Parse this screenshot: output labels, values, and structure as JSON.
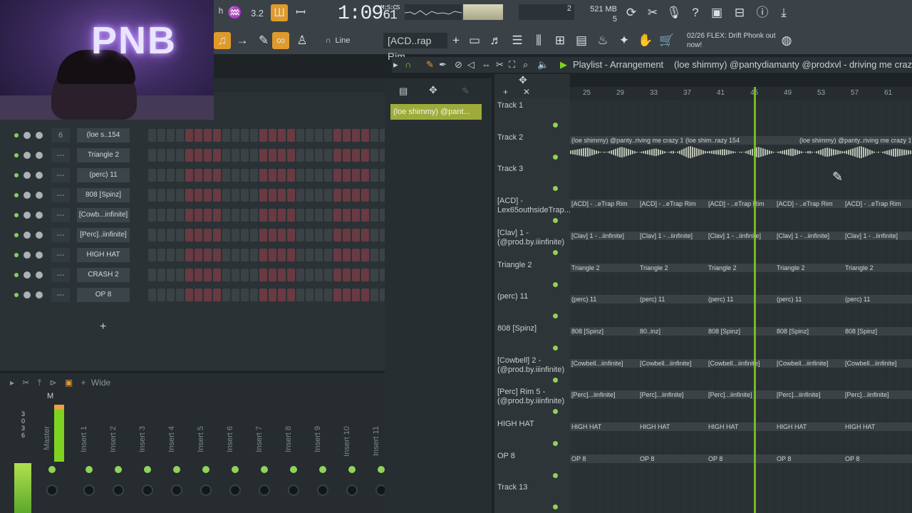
{
  "toolbar": {
    "time": "1:09",
    "time_sub": "61",
    "time_unit": "M:S:CS",
    "tempo": "3.2",
    "line_mode": "Line",
    "pattern": "[ACD..rap Rim",
    "memory": "521 MB",
    "cpu_top": "2",
    "cpu_bottom": "5",
    "news_date": "02/26",
    "news_text": "FLEX: Drift Phonk out now!"
  },
  "channel_rack": {
    "rows": [
      {
        "num": "6",
        "name": "(loe s..154"
      },
      {
        "num": "---",
        "name": "Triangle 2"
      },
      {
        "num": "---",
        "name": "(perc) 11"
      },
      {
        "num": "---",
        "name": "808 [Spinz]"
      },
      {
        "num": "---",
        "name": "[Cowb...infinite]"
      },
      {
        "num": "---",
        "name": "[Perc]..iinfinite]"
      },
      {
        "num": "---",
        "name": "HIGH HAT"
      },
      {
        "num": "---",
        "name": "CRASH 2"
      },
      {
        "num": "---",
        "name": "OP 8"
      }
    ],
    "add_label": "+"
  },
  "mixer": {
    "mode": "Wide",
    "master_label": "M",
    "scale": [
      "3",
      "0",
      "3",
      "6"
    ],
    "strips": [
      "Master",
      "Insert 1",
      "Insert 2",
      "Insert 3",
      "Insert 4",
      "Insert 5",
      "Insert 6",
      "Insert 7",
      "Insert 8",
      "Insert 9",
      "Insert 10",
      "Insert 11"
    ]
  },
  "picker": {
    "selected_clip": "(loe shimmy) @pant..."
  },
  "playlist": {
    "title": "Playlist - Arrangement",
    "subtitle": "(loe shimmy) @pantydiamanty @prodxvl - driving me crazy",
    "ruler": [
      "25",
      "29",
      "33",
      "37",
      "41",
      "45",
      "49",
      "53",
      "57",
      "61"
    ],
    "tracks": [
      {
        "name": "Track 1",
        "clips": []
      },
      {
        "name": "Track 2",
        "clips": [
          "(loe shimmy) @panty..riving me crazy 154",
          "(loe shim..razy 154",
          "(loe shimmy) @panty..riving me crazy 15"
        ]
      },
      {
        "name": "Track 3",
        "clips": []
      },
      {
        "name": "[ACD] - Lex65outhsideTrap...",
        "clips": [
          "[ACD] - ..eTrap Rim",
          "[ACD] - ..eTrap Rim",
          "[ACD] - ..eTrap Rim",
          "[ACD] - ..eTrap Rim",
          "[ACD] - ..eTrap Rim"
        ]
      },
      {
        "name": "[Clav] 1 - (@prod.by.iiinfinite)",
        "clips": [
          "[Clav] 1 - ..iinfinite]",
          "[Clav] 1 - ..iinfinite]",
          "[Clav] 1 - ..iinfinite]",
          "[Clav] 1 - ..iinfinite]",
          "[Clav] 1 - ..iinfinite]"
        ]
      },
      {
        "name": "Triangle 2",
        "clips": [
          "Triangle 2",
          "Triangle 2",
          "Triangle 2",
          "Triangle 2",
          "Triangle 2"
        ]
      },
      {
        "name": "(perc) 11",
        "clips": [
          "(perc) 11",
          "(perc) 11",
          "(perc) 11",
          "(perc) 11",
          "(perc) 11"
        ]
      },
      {
        "name": "808 [Spinz]",
        "clips": [
          "808 [Spinz]",
          "80..inz]",
          "808 [Spinz]",
          "808 [Spinz]",
          "808 [Spinz]"
        ]
      },
      {
        "name": "[Cowbell] 2 - (@prod.by.iiinfinite)",
        "clips": [
          "[Cowbell...iinfinite]",
          "[Cowbell...iinfinite]",
          "[Cowbell...iinfinite]",
          "[Cowbell...iinfinite]",
          "[Cowbell...iinfinite]"
        ]
      },
      {
        "name": "[Perc] Rim 5 - (@prod.by.iiinfinite)",
        "clips": [
          "[Perc]...iinfinite]",
          "[Perc]...iinfinite]",
          "[Perc]...iinfinite]",
          "[Perc]...iinfinite]",
          "[Perc]...iinfinite]"
        ]
      },
      {
        "name": "HIGH HAT",
        "clips": [
          "HIGH HAT",
          "HIGH HAT",
          "HIGH HAT",
          "HIGH HAT",
          "HIGH HAT"
        ]
      },
      {
        "name": "OP 8",
        "clips": [
          "OP 8",
          "OP 8",
          "OP 8",
          "OP 8",
          "OP 8"
        ]
      },
      {
        "name": "Track 13",
        "clips": []
      }
    ]
  },
  "webcam": {
    "neon_text": "PNB"
  },
  "colors": {
    "accent_green": "#7ed321",
    "step_red": "#6a3a43",
    "clip_green": "#9eab3a",
    "toolbar": "#3a4247"
  }
}
